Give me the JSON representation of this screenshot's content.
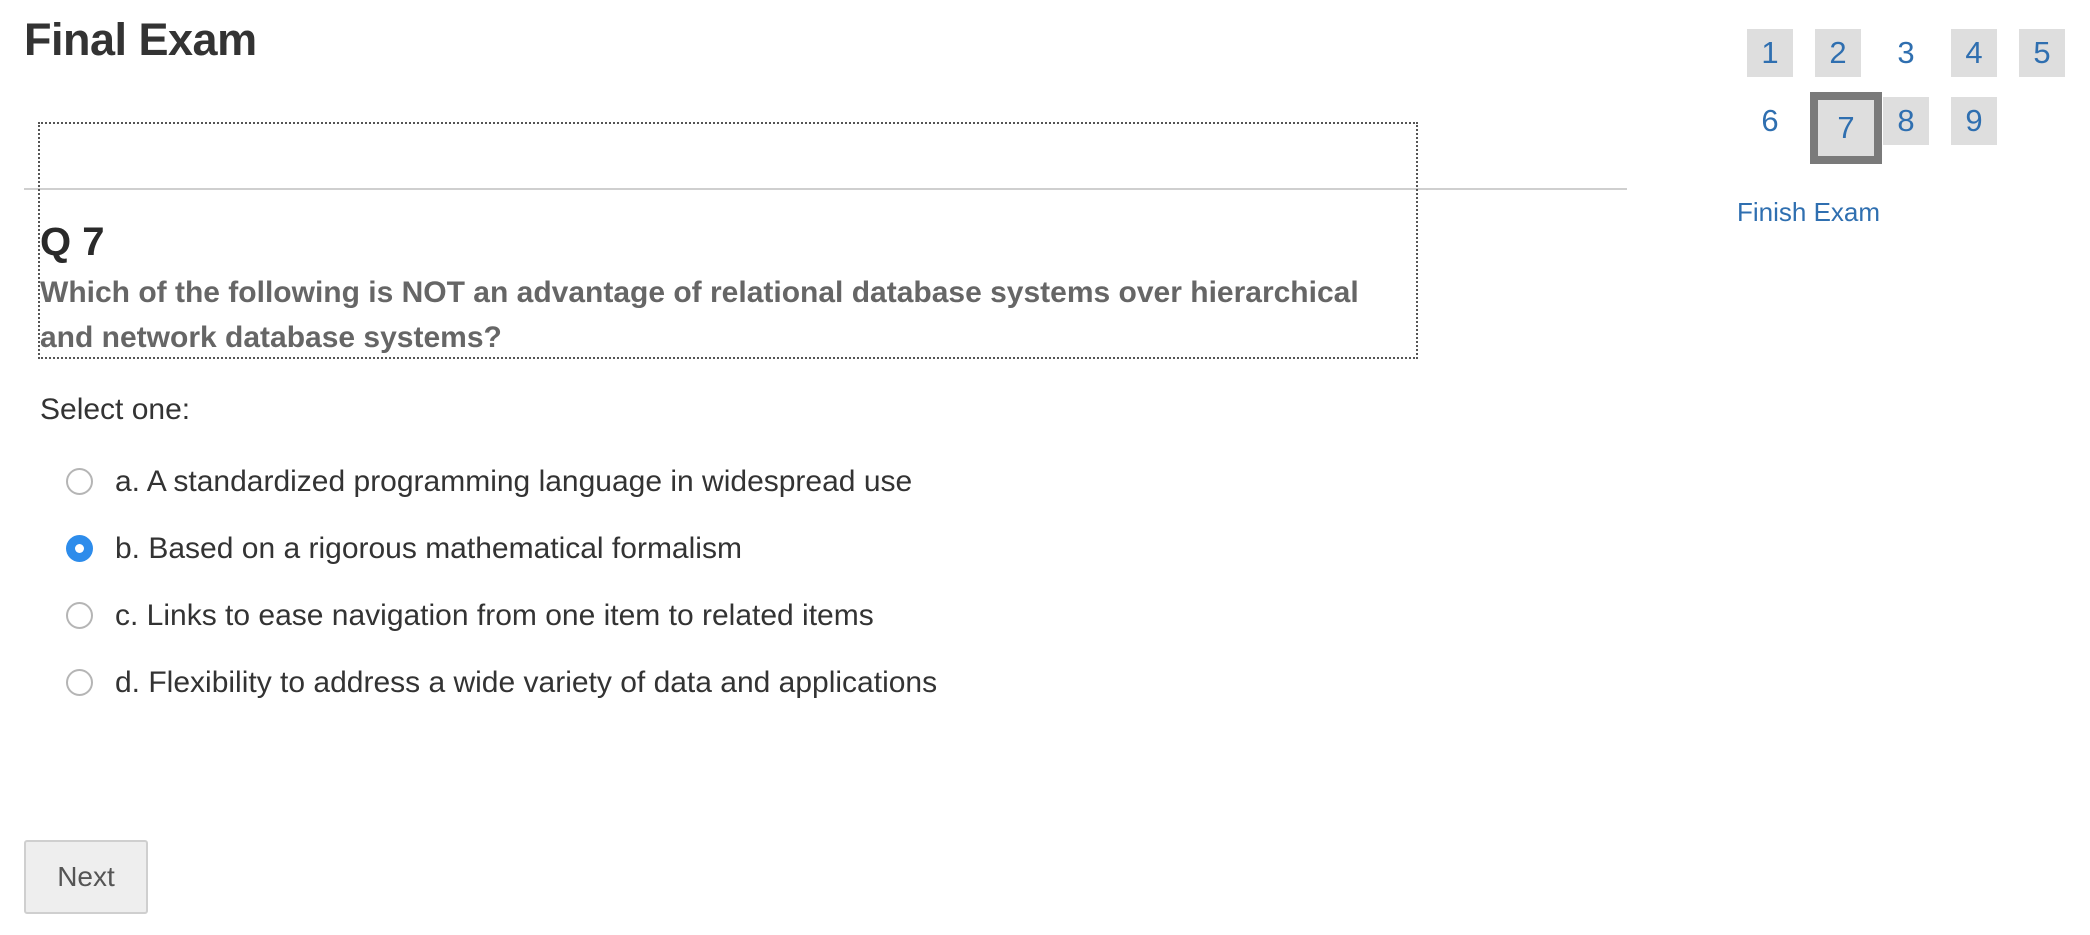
{
  "header": {
    "title": "Final Exam"
  },
  "question": {
    "number": "Q 7",
    "text": "Which of the following is NOT an advantage of relational database systems over hierarchical and network database systems?",
    "select_label": "Select one:",
    "options": [
      {
        "label": "a. A standardized programming language in widespread use",
        "selected": false
      },
      {
        "label": "b. Based on a rigorous mathematical formalism",
        "selected": true
      },
      {
        "label": "c. Links to ease navigation from one item to related items",
        "selected": false
      },
      {
        "label": "d. Flexibility to address a wide variety of data and applications",
        "selected": false
      }
    ]
  },
  "footer": {
    "next_label": "Next"
  },
  "navigation": {
    "questions": [
      {
        "label": "1",
        "status": "answered"
      },
      {
        "label": "2",
        "status": "answered"
      },
      {
        "label": "3",
        "status": "unanswered"
      },
      {
        "label": "4",
        "status": "answered"
      },
      {
        "label": "5",
        "status": "answered"
      },
      {
        "label": "6",
        "status": "unanswered"
      },
      {
        "label": "7",
        "status": "current"
      },
      {
        "label": "8",
        "status": "answered"
      },
      {
        "label": "9",
        "status": "answered"
      }
    ],
    "finish_label": "Finish Exam"
  },
  "colors": {
    "link": "#2f6fb0",
    "radio_selected": "#2d8ceb",
    "answered_bg": "#dedede",
    "current_border": "#7a7a7a"
  }
}
